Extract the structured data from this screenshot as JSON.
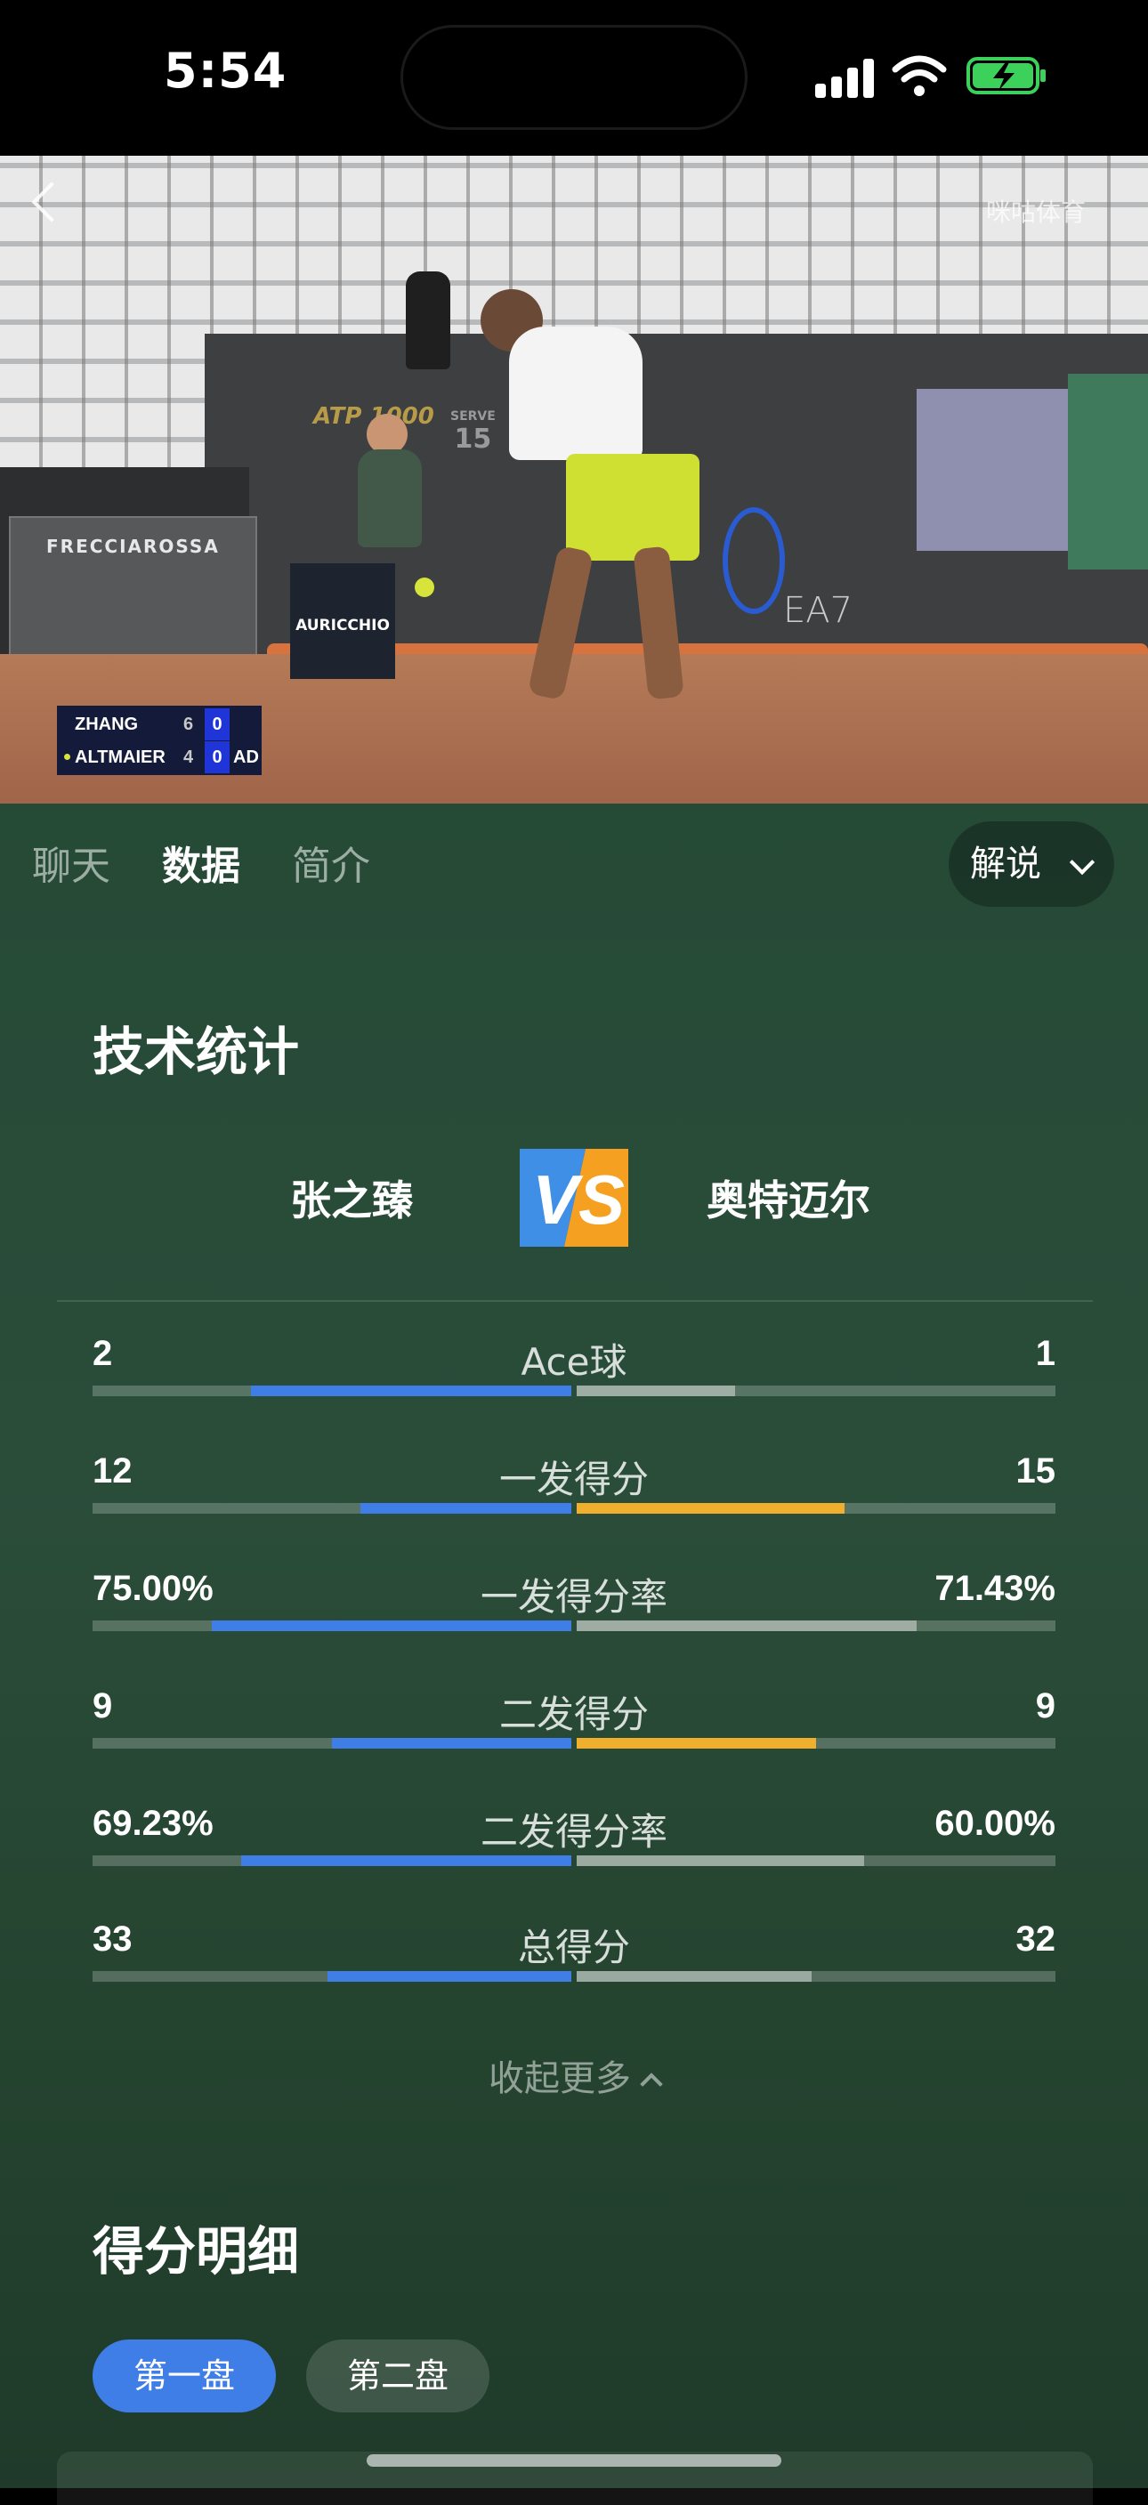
{
  "status_bar": {
    "time": "5:54"
  },
  "video": {
    "watermark": "咪咕体育",
    "sponsor_board": "FRECCIAROSSA",
    "sponsor_box": "AURICCHIO",
    "event_logo": "ATP 1000",
    "serve_label": "SERVE",
    "serve_speed": "15",
    "brand_board": "EA7",
    "scoreboard": [
      {
        "name": "ZHANG",
        "set": "6",
        "game": "0",
        "extra": ""
      },
      {
        "name": "ALTMAIER",
        "set": "4",
        "game": "0",
        "extra": "AD",
        "serving": true
      }
    ]
  },
  "tabs": [
    {
      "label": "聊天",
      "active": false
    },
    {
      "label": "数据",
      "active": true
    },
    {
      "label": "简介",
      "active": false
    }
  ],
  "commentary_button": "解说",
  "stats_section": {
    "title": "技术统计",
    "player_left": "张之臻",
    "player_right": "奥特迈尔",
    "vs_text": "VS",
    "left_color": "#3f7ee6",
    "right_color": "#f0b02e",
    "rows": [
      {
        "label": "Ace球",
        "left": "2",
        "right": "1",
        "left_frac": 0.67,
        "right_frac": 0.33,
        "right_highlight": false
      },
      {
        "label": "一发得分",
        "left": "12",
        "right": "15",
        "left_frac": 0.44,
        "right_frac": 0.56,
        "right_highlight": true
      },
      {
        "label": "一发得分率",
        "left": "75.00%",
        "right": "71.43%",
        "left_frac": 0.75,
        "right_frac": 0.71,
        "right_highlight": false
      },
      {
        "label": "二发得分",
        "left": "9",
        "right": "9",
        "left_frac": 0.5,
        "right_frac": 0.5,
        "right_highlight": true
      },
      {
        "label": "二发得分率",
        "left": "69.23%",
        "right": "60.00%",
        "left_frac": 0.69,
        "right_frac": 0.6,
        "right_highlight": false
      },
      {
        "label": "总得分",
        "left": "33",
        "right": "32",
        "left_frac": 0.51,
        "right_frac": 0.49,
        "right_highlight": false
      }
    ],
    "collapse_label": "收起更多"
  },
  "points_section": {
    "title": "得分明细",
    "sets": [
      {
        "label": "第一盘",
        "active": true
      },
      {
        "label": "第二盘",
        "active": false
      }
    ]
  }
}
